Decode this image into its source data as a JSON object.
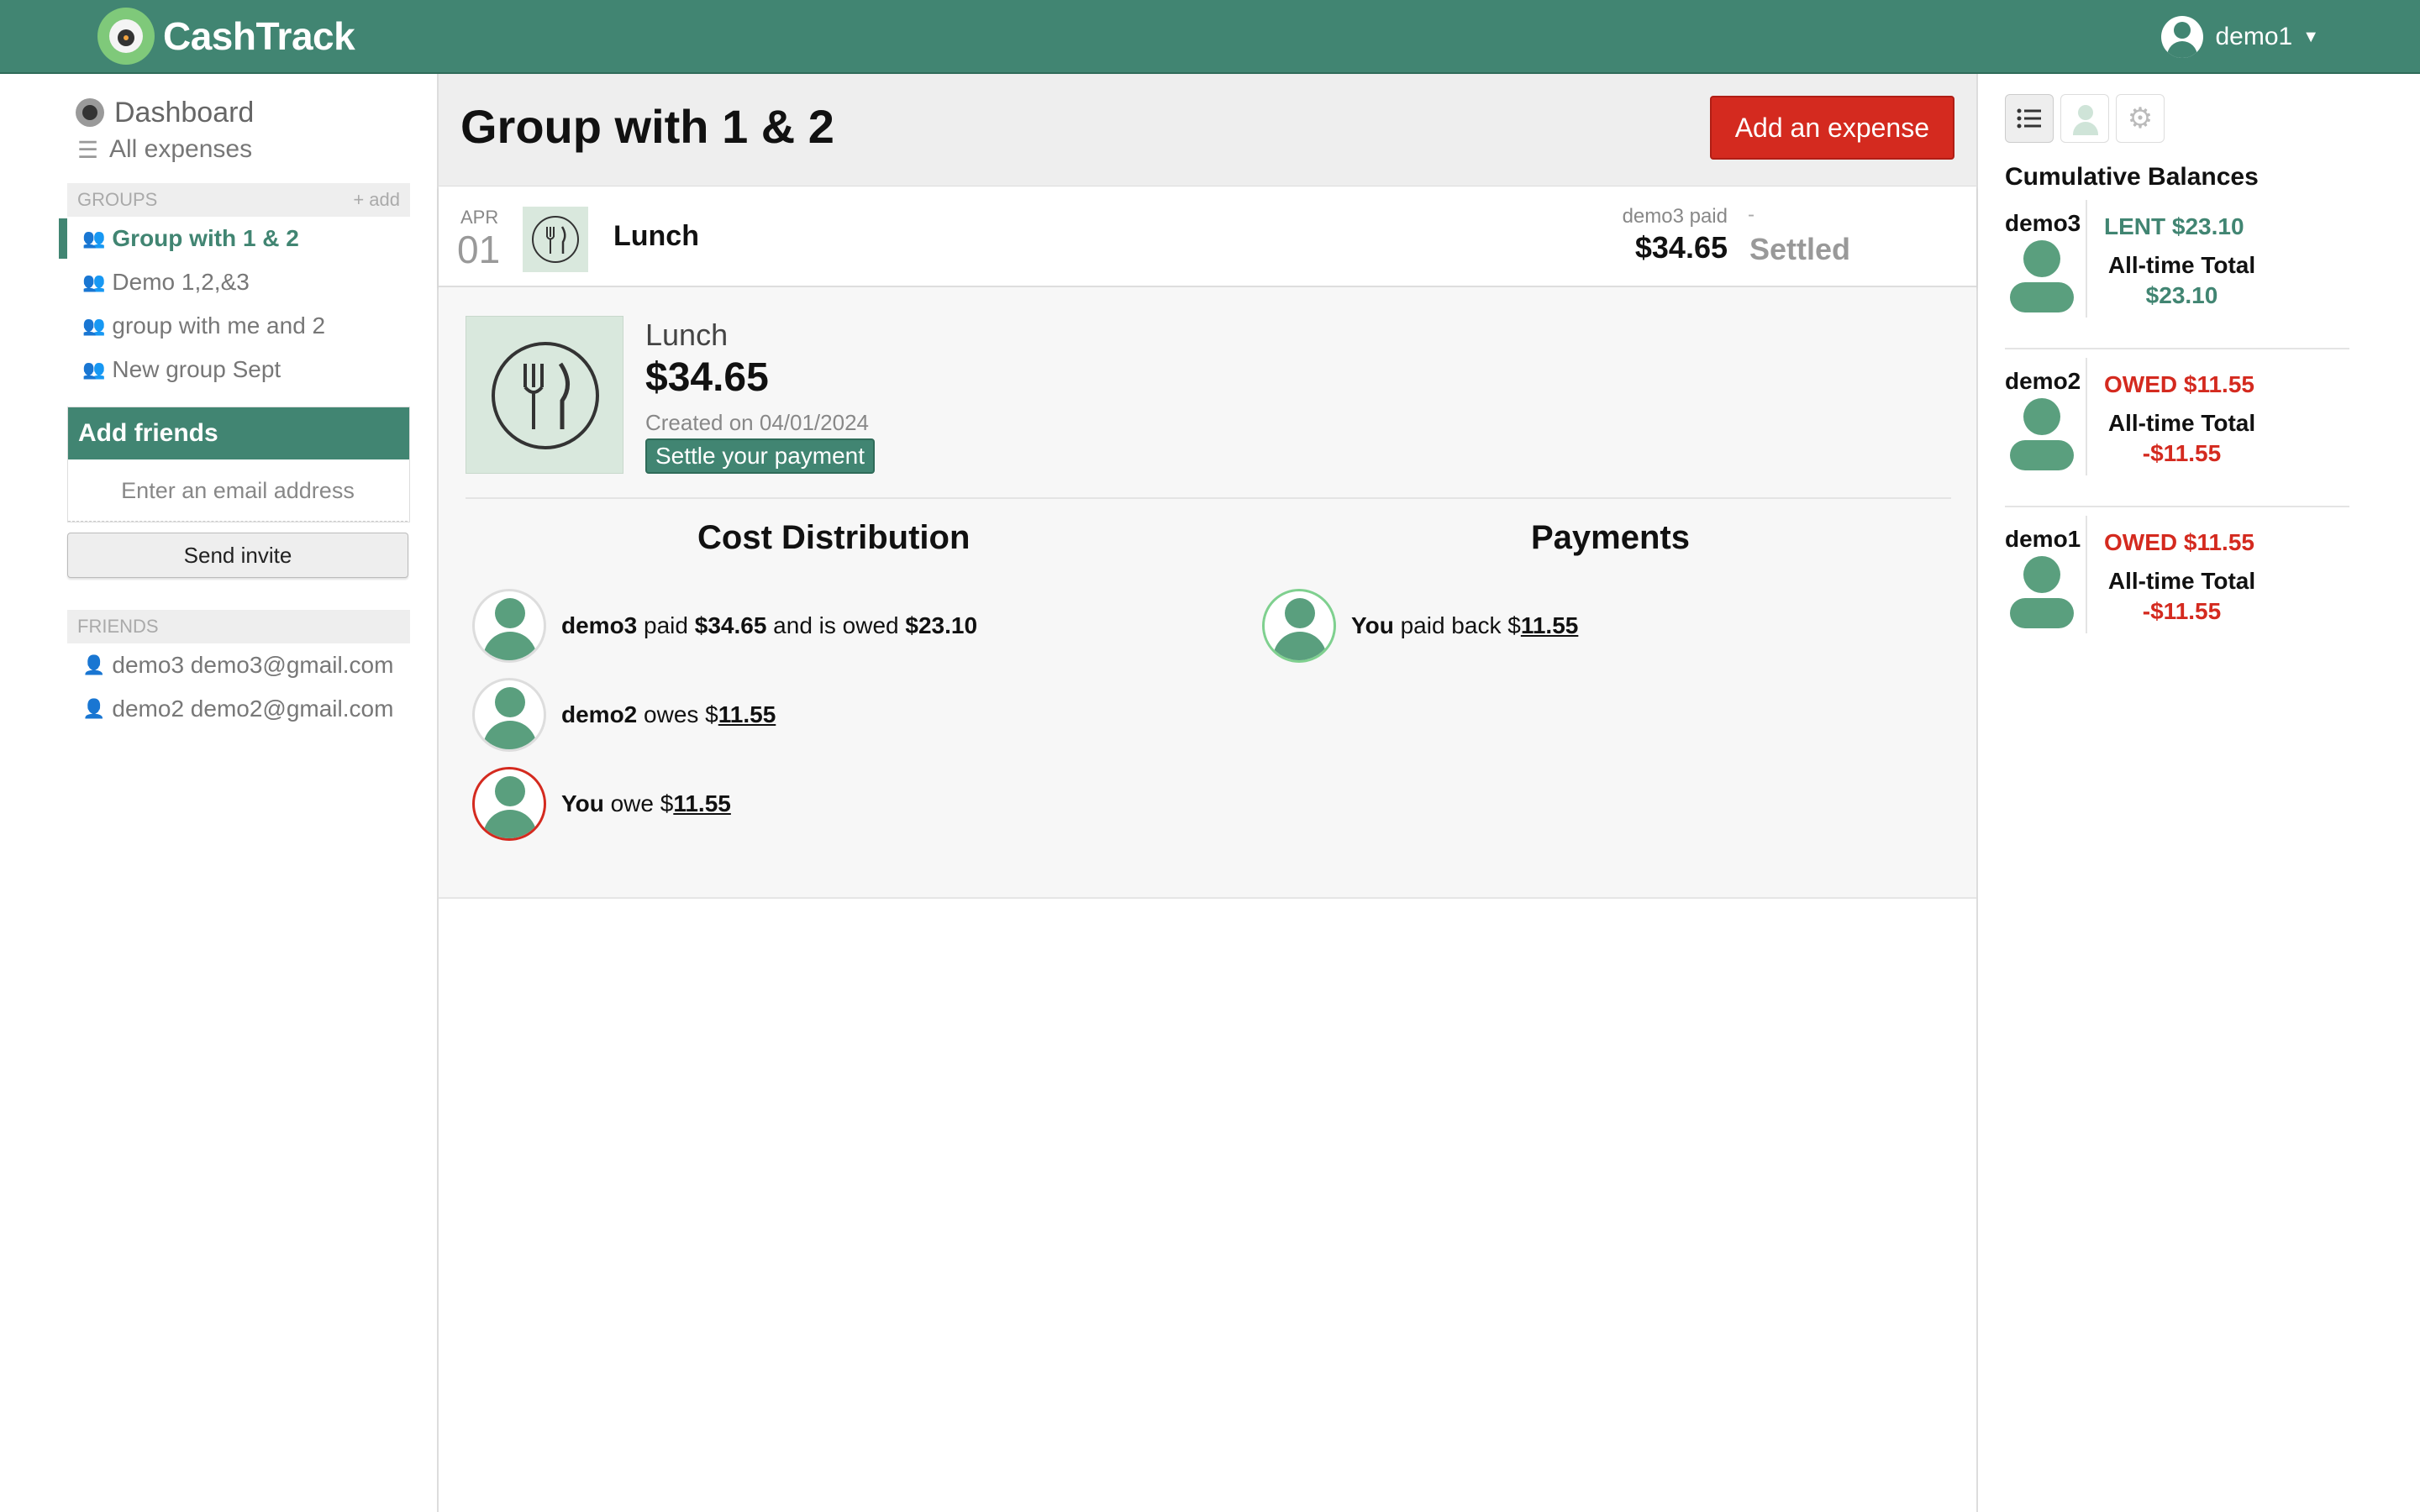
{
  "app": {
    "name": "CashTrack"
  },
  "user_menu": {
    "username": "demo1"
  },
  "sidebar": {
    "dashboard_label": "Dashboard",
    "all_expenses_label": "All expenses",
    "groups_header": "GROUPS",
    "groups_add_label": "+ add",
    "groups": [
      {
        "label": "Group with 1 & 2",
        "active": true
      },
      {
        "label": "Demo 1,2,&3"
      },
      {
        "label": "group with me and 2"
      },
      {
        "label": "New group Sept"
      }
    ],
    "add_friends": {
      "title": "Add friends",
      "email_placeholder": "Enter an email address",
      "send_label": "Send invite"
    },
    "friends_header": "FRIENDS",
    "friends": [
      {
        "label": "demo3 demo3@gmail.com"
      },
      {
        "label": "demo2 demo2@gmail.com"
      }
    ]
  },
  "main": {
    "title": "Group with 1 & 2",
    "add_expense_label": "Add an expense",
    "expense": {
      "month": "APR",
      "day": "01",
      "name": "Lunch",
      "paid_label": "demo3 paid",
      "paid_amount": "$34.65",
      "dash": "-",
      "status": "Settled"
    },
    "detail": {
      "name": "Lunch",
      "amount": "$34.65",
      "created": "Created on 04/01/2024",
      "settle_label": "Settle your payment",
      "cost_distribution_title": "Cost Distribution",
      "payments_title": "Payments",
      "distribution": [
        {
          "name": "demo3",
          "t1": " paid ",
          "amt1": "$34.65",
          "t2": " and is owed ",
          "amt2": "$23.10"
        },
        {
          "name": "demo2",
          "t1": " owes $",
          "amt1": "11.55"
        },
        {
          "name": "You",
          "t1": " owe $",
          "amt1": "11.55"
        }
      ],
      "payments": [
        {
          "name": "You",
          "t1": " paid back $",
          "amt1": "11.55"
        }
      ]
    }
  },
  "right_panel": {
    "title": "Cumulative Balances",
    "tab_icons": [
      "list-icon",
      "person-icon",
      "gear-icon"
    ],
    "total_label": "All-time Total",
    "balances": [
      {
        "name": "demo3",
        "status": "LENT $23.10",
        "total": "$23.10",
        "color": "#418572"
      },
      {
        "name": "demo2",
        "status": "OWED $11.55",
        "total": "-$11.55",
        "color": "#d42a1f"
      },
      {
        "name": "demo1",
        "status": "OWED $11.55",
        "total": "-$11.55",
        "color": "#d42a1f"
      }
    ]
  },
  "colors": {
    "brand": "#418572",
    "danger": "#d42a1f"
  }
}
